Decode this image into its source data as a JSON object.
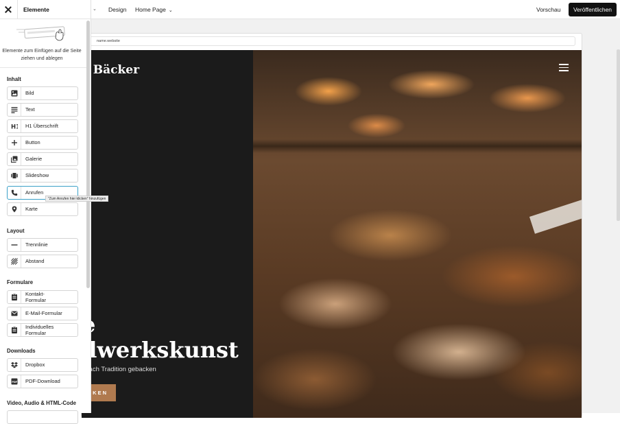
{
  "topbar": {
    "design": "Design",
    "home_page": "Home Page",
    "preview": "Vorschau",
    "publish": "Veröffentlichen"
  },
  "browser": {
    "url": "name.website"
  },
  "site": {
    "title_fragment": "e Bäcker",
    "hero_line1": "e",
    "hero_line2": "dwerkskunst",
    "hero_sub": "t nach Tradition gebacken",
    "hero_button": "CKEN"
  },
  "panel": {
    "title": "Elemente",
    "intro": "Elemente zum Einfügen auf die Seite ziehen und ablegen",
    "sections": {
      "inhalt": "Inhalt",
      "layout": "Layout",
      "formulare": "Formulare",
      "downloads": "Downloads",
      "video": "Video, Audio & HTML-Code"
    },
    "items": {
      "bild": "Bild",
      "text": "Text",
      "h1": "H1 Überschrift",
      "button": "Button",
      "galerie": "Galerie",
      "slideshow": "Slideshow",
      "anrufen": "Anrufen",
      "karte": "Karte",
      "trennlinie": "Trennlinie",
      "abstand": "Abstand",
      "kontakt_1": "Kontakt-",
      "kontakt_2": "Formular",
      "email": "E-Mail-Formular",
      "indiv_1": "Individuelles",
      "indiv_2": "Formular",
      "dropbox": "Dropbox",
      "pdf": "PDF-Download"
    },
    "tooltip": "\"Zum Anrufen hier klicken\" hinzufügen"
  },
  "icons": {
    "close": "close-icon",
    "bild": "image-icon",
    "text": "text-lines-icon",
    "h1": "heading-icon",
    "button": "plus-icon",
    "galerie": "gallery-icon",
    "slideshow": "slideshow-icon",
    "anrufen": "phone-icon",
    "karte": "map-pin-icon",
    "trennlinie": "divider-icon",
    "abstand": "spacer-icon",
    "form": "form-icon",
    "email": "mail-icon",
    "dropbox": "dropbox-icon",
    "pdf": "pdf-icon",
    "menu": "hamburger-icon"
  },
  "colors": {
    "accent": "#3aa0c8",
    "publish_bg": "#111111",
    "hero_button": "#b07a4f"
  }
}
